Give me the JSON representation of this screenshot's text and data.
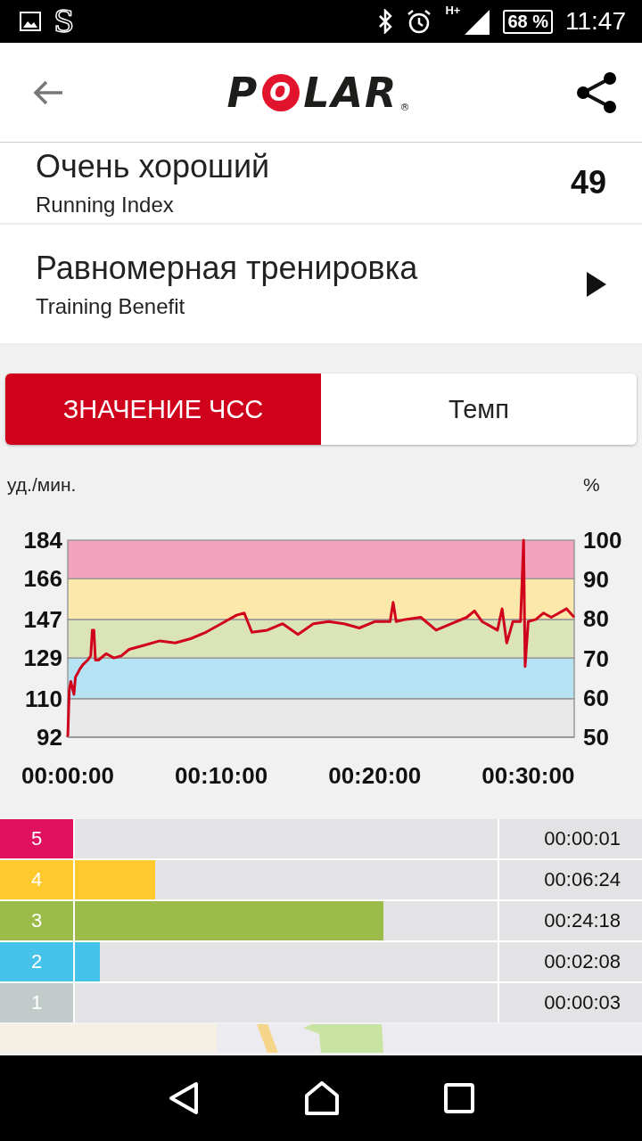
{
  "status_bar": {
    "app_glyph": "S",
    "network": "H+",
    "battery": "68 %",
    "time": "11:47"
  },
  "header": {
    "logo": "POLAR",
    "logo_mark": "®"
  },
  "summary": [
    {
      "value": "Очень хороший",
      "label": "Running Index",
      "number": "49",
      "kind": "number"
    },
    {
      "value": "Равномерная тренировка",
      "label": "Training Benefit",
      "kind": "arrow"
    }
  ],
  "tabs": [
    {
      "label": "ЗНАЧЕНИЕ ЧСС",
      "selected": true
    },
    {
      "label": "Темп",
      "selected": false
    }
  ],
  "hr_chart": {
    "right_unit": "%",
    "right_ticks": [
      "100",
      "90",
      "80",
      "70",
      "60",
      "50"
    ],
    "chart_data": {
      "type": "line",
      "ylabel": "уд./мин.",
      "xlim": [
        0,
        33
      ],
      "ylim": [
        92,
        184
      ],
      "bands": [
        {
          "axis": "y",
          "from": 92,
          "to": 110,
          "color": "#e8e8e8"
        },
        {
          "axis": "y",
          "from": 110,
          "to": 129,
          "color": "#b6e3f3"
        },
        {
          "axis": "y",
          "from": 129,
          "to": 147,
          "color": "#dbe4b9"
        },
        {
          "axis": "y",
          "from": 147,
          "to": 166,
          "color": "#fde8ab"
        },
        {
          "axis": "y",
          "from": 166,
          "to": 184,
          "color": "#f2a3be"
        }
      ],
      "yticks": [
        92,
        110,
        129,
        147,
        166,
        184
      ],
      "xticks": [
        {
          "value": 0,
          "label": "00:00:00"
        },
        {
          "value": 10,
          "label": "00:10:00"
        },
        {
          "value": 20,
          "label": "00:20:00"
        },
        {
          "value": 30,
          "label": "00:30:00"
        }
      ],
      "x": [
        0,
        0.1,
        0.2,
        0.4,
        0.5,
        0.8,
        1,
        1.3,
        1.5,
        1.6,
        1.7,
        1.8,
        2,
        2.5,
        3,
        3.5,
        4,
        5,
        6,
        7,
        8,
        9,
        10,
        11,
        11.5,
        12,
        13,
        14,
        15,
        16,
        17,
        18,
        19,
        20,
        21,
        21.2,
        21.4,
        22,
        23,
        24,
        25,
        26,
        26.5,
        27,
        28,
        28.3,
        28.6,
        29,
        29.5,
        29.7,
        29.8,
        30,
        30.5,
        31,
        31.5,
        32,
        32.5,
        33
      ],
      "series": [
        {
          "color": "#d0021b",
          "values": [
            92,
            114,
            118,
            112,
            120,
            124,
            126,
            128,
            130,
            142,
            142,
            128,
            128,
            131,
            129,
            130,
            133,
            135,
            137,
            136,
            138,
            141,
            145,
            149,
            150,
            141,
            142,
            145,
            140,
            145,
            146,
            145,
            143,
            146,
            146,
            155,
            146,
            147,
            148,
            142,
            145,
            148,
            151,
            146,
            142,
            152,
            136,
            146,
            146,
            184,
            125,
            146,
            147,
            150,
            148,
            150,
            152,
            148
          ]
        }
      ]
    }
  },
  "zones": [
    {
      "number": "5",
      "time": "00:00:01",
      "color": "#e0115f"
    },
    {
      "number": "4",
      "time": "00:06:24",
      "level": 0.19,
      "color": "#ffc82c"
    },
    {
      "number": "3",
      "time": "00:24:18",
      "level": 0.73,
      "color": "#9cbc4a"
    },
    {
      "number": "2",
      "time": "00:02:08",
      "level": 0.06,
      "color": "#45c3ea"
    },
    {
      "number": "1",
      "time": "00:00:03",
      "color": "#c3cbca"
    }
  ]
}
